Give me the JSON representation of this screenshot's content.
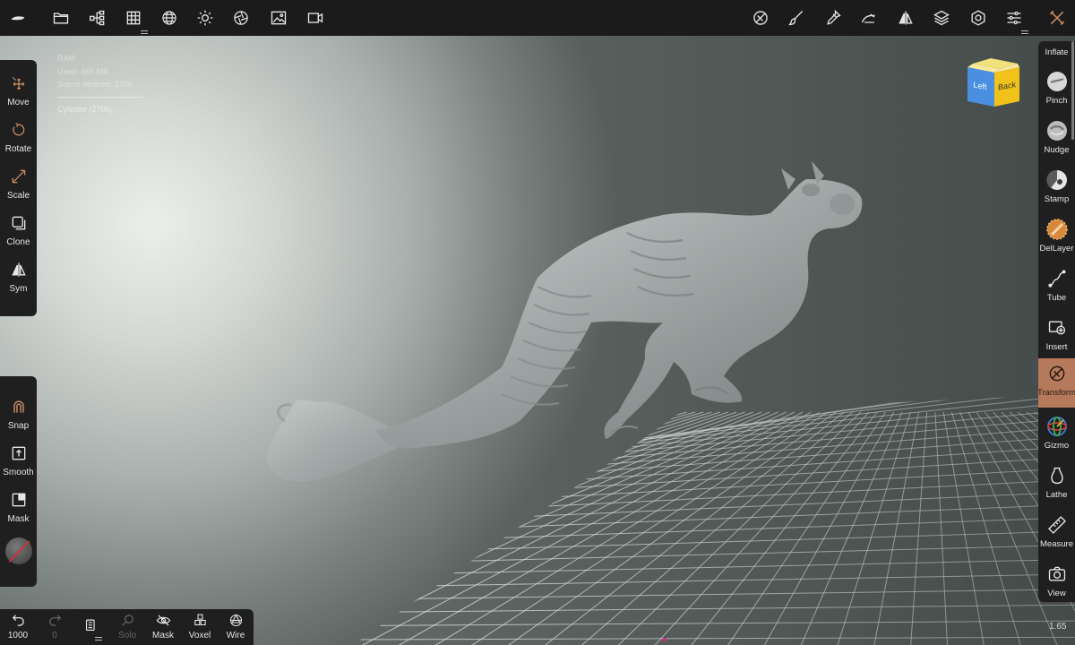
{
  "topbar": {
    "left_icons": [
      "nomad-logo-icon",
      "folder-icon",
      "scene-tree-icon",
      "topology-grid-icon",
      "wireframe-sphere-icon",
      "light-sun-icon",
      "material-shading-icon",
      "background-image-icon",
      "camera-video-icon"
    ],
    "right_icons": [
      "tool-no-transform-icon",
      "paint-brush-icon",
      "dropper-icon",
      "stroke-settings-icon",
      "symmetry-icon",
      "layers-icon",
      "settings-gear-icon",
      "menu-sliders-icon",
      "tools-crossed-icon"
    ]
  },
  "info": {
    "ram_label": "RAM",
    "used": "Used: 465 MB",
    "vertices": "Scene vertices: 270k",
    "mesh_name": "Cylinder (270k)"
  },
  "left_tools": [
    {
      "label": "Move",
      "icon": "move-arrows-icon"
    },
    {
      "label": "Rotate",
      "icon": "rotate-icon"
    },
    {
      "label": "Scale",
      "icon": "scale-icon"
    },
    {
      "label": "Clone",
      "icon": "clone-icon"
    },
    {
      "label": "Sym",
      "icon": "symmetry-icon"
    }
  ],
  "left_options": [
    {
      "label": "Snap",
      "icon": "magnet-icon"
    },
    {
      "label": "Smooth",
      "icon": "smooth-icon"
    },
    {
      "label": "Mask",
      "icon": "mask-icon"
    }
  ],
  "bottom_bar": {
    "undo_count": "1000",
    "redo_count": "0",
    "items": [
      {
        "label": "Solo",
        "icon": "search-icon",
        "dim": true
      },
      {
        "label": "Mask",
        "icon": "eye-hidden-icon",
        "dim": false
      },
      {
        "label": "Voxel",
        "icon": "voxel-cubes-icon",
        "dim": false
      },
      {
        "label": "Wire",
        "icon": "wire-sphere-icon",
        "dim": false
      }
    ]
  },
  "right_tools": [
    {
      "label": "Inflate",
      "icon": "inflate-icon"
    },
    {
      "label": "Pinch",
      "icon": "pinch-icon"
    },
    {
      "label": "Nudge",
      "icon": "nudge-icon"
    },
    {
      "label": "Stamp",
      "icon": "stamp-icon"
    },
    {
      "label": "DelLayer",
      "icon": "del-layer-icon"
    },
    {
      "label": "Tube",
      "icon": "tube-icon"
    },
    {
      "label": "Insert",
      "icon": "insert-icon"
    },
    {
      "label": "Transform",
      "icon": "transform-icon",
      "active": true
    },
    {
      "label": "Gizmo",
      "icon": "gizmo-icon"
    },
    {
      "label": "Lathe",
      "icon": "lathe-icon"
    },
    {
      "label": "Measure",
      "icon": "measure-icon"
    },
    {
      "label": "View",
      "icon": "camera-view-icon"
    }
  ],
  "view_cube": {
    "left": "Left",
    "back": "Back"
  },
  "version": "1.65",
  "colors": {
    "accent": "#b57a5b",
    "panel": "#1f1f1f",
    "topbar": "#1b1b1b"
  }
}
